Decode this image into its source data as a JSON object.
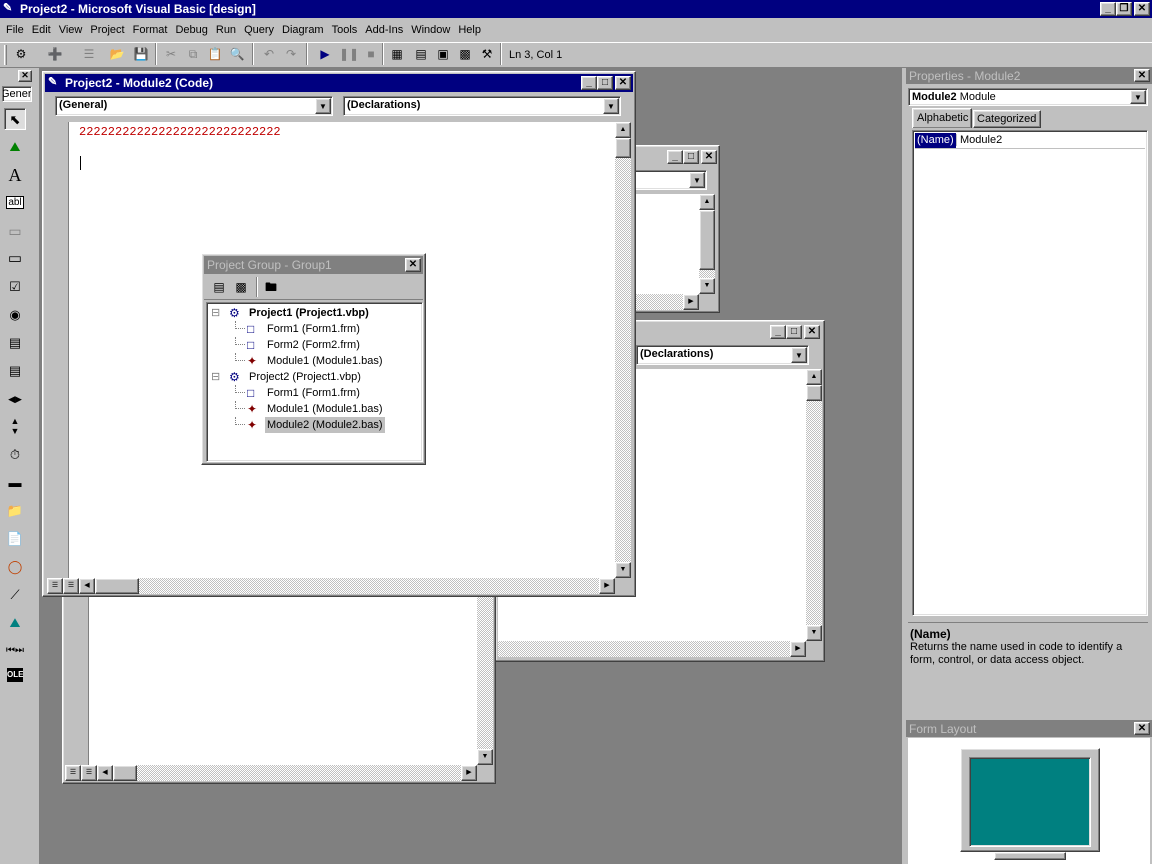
{
  "app": {
    "title": "Project2 - Microsoft Visual Basic [design]",
    "menu": [
      "File",
      "Edit",
      "View",
      "Project",
      "Format",
      "Debug",
      "Run",
      "Query",
      "Diagram",
      "Tools",
      "Add-Ins",
      "Window",
      "Help"
    ],
    "status_position": "Ln 3, Col 1"
  },
  "toolbox": {
    "tab_label": "Genera",
    "items": [
      "pointer-icon",
      "picturebox-icon",
      "label-icon",
      "textbox-icon",
      "frame-icon",
      "commandbutton-icon",
      "checkbox-icon",
      "optionbutton-icon",
      "combobox-icon",
      "listbox-icon",
      "hscrollbar-icon",
      "vscrollbar-icon",
      "timer-icon",
      "drivelistbox-icon",
      "dirlistbox-icon",
      "filelistbox-icon",
      "shape-icon",
      "line-icon",
      "image-icon",
      "data-icon",
      "ole-icon"
    ],
    "label_glyph": "A",
    "textbox_glyph": "abl"
  },
  "code_window": {
    "title": "Project2 - Module2 (Code)",
    "object_combo": "(General)",
    "proc_combo": "(Declarations)",
    "code_line": "2222222222222222222222222222"
  },
  "back_window2": {
    "proc_combo": "(Declarations)"
  },
  "project_group": {
    "title": "Project Group - Group1",
    "tree": [
      {
        "label": "Project1 (Project1.vbp)",
        "level": 0,
        "bold": true,
        "icon": "project-icon"
      },
      {
        "label": "Form1 (Form1.frm)",
        "level": 1,
        "icon": "form-icon"
      },
      {
        "label": "Form2 (Form2.frm)",
        "level": 1,
        "icon": "form-icon"
      },
      {
        "label": "Module1 (Module1.bas)",
        "level": 1,
        "icon": "module-icon"
      },
      {
        "label": "Project2 (Project1.vbp)",
        "level": 0,
        "icon": "project-icon"
      },
      {
        "label": "Form1 (Form1.frm)",
        "level": 1,
        "icon": "form-icon"
      },
      {
        "label": "Module1 (Module1.bas)",
        "level": 1,
        "icon": "module-icon"
      },
      {
        "label": "Module2 (Module2.bas)",
        "level": 1,
        "icon": "module-icon",
        "selected": true
      }
    ]
  },
  "properties": {
    "title": "Properties - Module2",
    "object_name": "Module2",
    "object_type": "Module",
    "tabs": [
      "Alphabetic",
      "Categorized"
    ],
    "rows": [
      {
        "name": "(Name)",
        "value": "Module2"
      }
    ],
    "desc_title": "(Name)",
    "desc_text": "Returns the name used in code to identify a form, control, or data access object."
  },
  "form_layout": {
    "title": "Form Layout",
    "screen_color": "#008080"
  },
  "colors": {
    "active_title": "#000080",
    "inactive_title": "#808080",
    "mdi_background": "#808080",
    "code_text": "#c00000",
    "selection": "#000080"
  }
}
